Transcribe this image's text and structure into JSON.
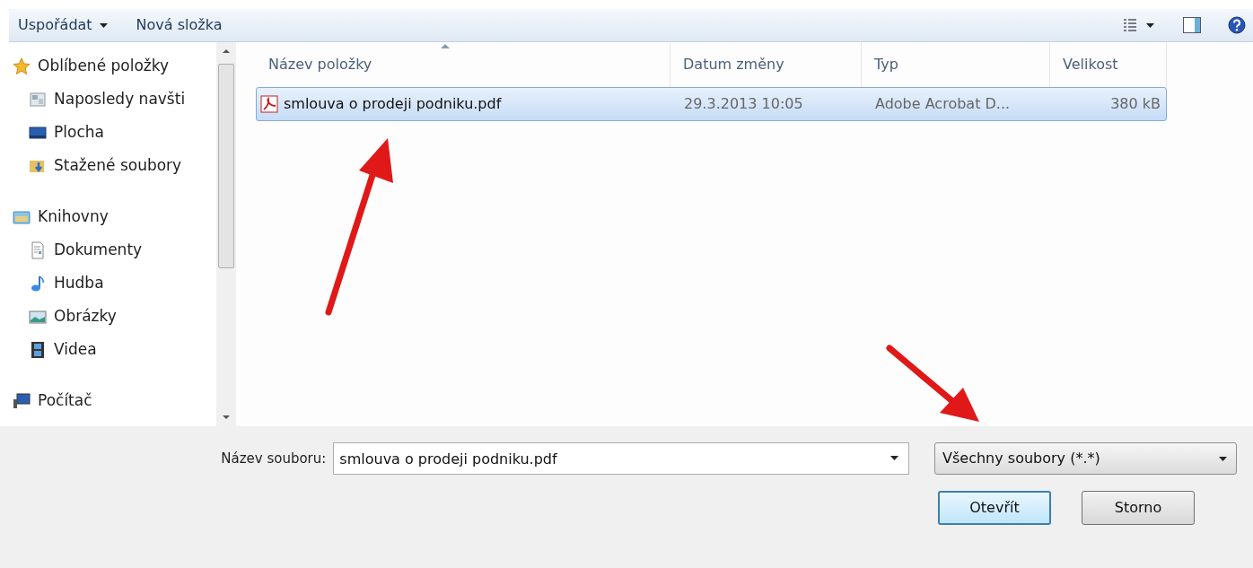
{
  "toolbar": {
    "items": [
      {
        "label": "Uspořádat",
        "dropdown": true
      },
      {
        "label": "Nová složka",
        "dropdown": false
      }
    ]
  },
  "sidebar": {
    "groups": [
      {
        "label": "Oblíbené položky",
        "children": [
          {
            "label": "Naposledy navšti"
          },
          {
            "label": "Plocha"
          },
          {
            "label": "Stažené soubory"
          }
        ]
      },
      {
        "label": "Knihovny",
        "children": [
          {
            "label": "Dokumenty"
          },
          {
            "label": "Hudba"
          },
          {
            "label": "Obrázky"
          },
          {
            "label": "Videa"
          }
        ]
      },
      {
        "label": "Počítač"
      }
    ]
  },
  "table": {
    "columns": [
      "Název položky",
      "Datum změny",
      "Typ",
      "Velikost"
    ],
    "rows": [
      {
        "name": "smlouva o prodeji podniku.pdf",
        "date": "29.3.2013 10:05",
        "type": "Adobe Acrobat D...",
        "size": "380 kB",
        "selected": true
      }
    ]
  },
  "footer": {
    "filename_label": "Název souboru:",
    "filename_value": "smlouva o prodeji podniku.pdf",
    "filter": "Všechny soubory (*.*)",
    "buttons": [
      {
        "label": "Otevřít",
        "default": true
      },
      {
        "label": "Storno",
        "default": false
      }
    ]
  }
}
